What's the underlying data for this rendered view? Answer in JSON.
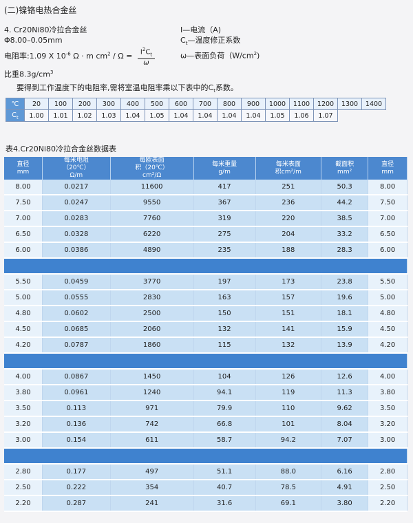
{
  "section_title": "(二)镍铬电热合金丝",
  "spec": {
    "grade": "4. Cr20Ni80冷拉合金丝",
    "diameter_range": "Φ8.00–0.05mm",
    "resistivity_prefix": "电阻率:1.09 X 10",
    "resistivity_exp": "-6",
    "resistivity_unit_a": " Ω · m  cm",
    "resistivity_unit_sup": "2",
    "resistivity_unit_b": " / Ω =",
    "formula_num_a": "I",
    "formula_num_sup": "2",
    "formula_num_b": "C",
    "formula_num_sub": "t",
    "formula_den": "ω",
    "density_prefix": "比重8.3g/cm",
    "density_exp": "3"
  },
  "legend": {
    "current": "I—电流（A)",
    "coef_prefix": "C",
    "coef_sub": "t",
    "coef_text": "—温度修正系数",
    "load_prefix": "ω—表面负荷（W/cm",
    "load_sup": "2",
    "load_suffix": ")"
  },
  "note": {
    "text_a": "要得到工作温度下的电阻率,需将室温电阻率乘以下表中的C",
    "text_sub": "t",
    "text_b": "系数。"
  },
  "ct_table": {
    "row_label_temp": "℃",
    "row_label_ct": "C",
    "row_label_ct_sub": "t",
    "temps": [
      "20",
      "100",
      "200",
      "300",
      "400",
      "500",
      "600",
      "700",
      "800",
      "900",
      "1000",
      "1100",
      "1200",
      "1300",
      "1400"
    ],
    "coefs": [
      "1.00",
      "1.01",
      "1.02",
      "1.03",
      "1.04",
      "1.05",
      "1.04",
      "1.04",
      "1.04",
      "1.04",
      "1.05",
      "1.06",
      "1.07",
      "",
      ""
    ]
  },
  "table_title": "表4.Cr20Ni80冷拉合金丝数据表",
  "data_table": {
    "headers": [
      {
        "l1": "直径",
        "l2": "mm",
        "l3": ""
      },
      {
        "l1": "每米电阻",
        "l2": "（20℃）",
        "l3": "Ω/m"
      },
      {
        "l1": "每欧表面",
        "l2": "积（20℃）",
        "l3": "cm²/Ω"
      },
      {
        "l1": "每米重量",
        "l2": "g/m",
        "l3": ""
      },
      {
        "l1": "每米表面",
        "l2": "积cm²/m",
        "l3": ""
      },
      {
        "l1": "截面积",
        "l2": "mm²",
        "l3": ""
      },
      {
        "l1": "直径",
        "l2": "mm",
        "l3": ""
      }
    ],
    "groups": [
      [
        [
          "8.00",
          "0.0217",
          "11600",
          "417",
          "251",
          "50.3",
          "8.00"
        ],
        [
          "7.50",
          "0.0247",
          "9550",
          "367",
          "236",
          "44.2",
          "7.50"
        ],
        [
          "7.00",
          "0.0283",
          "7760",
          "319",
          "220",
          "38.5",
          "7.00"
        ],
        [
          "6.50",
          "0.0328",
          "6220",
          "275",
          "204",
          "33.2",
          "6.50"
        ],
        [
          "6.00",
          "0.0386",
          "4890",
          "235",
          "188",
          "28.3",
          "6.00"
        ]
      ],
      [
        [
          "5.50",
          "0.0459",
          "3770",
          "197",
          "173",
          "23.8",
          "5.50"
        ],
        [
          "5.00",
          "0.0555",
          "2830",
          "163",
          "157",
          "19.6",
          "5.00"
        ],
        [
          "4.80",
          "0.0602",
          "2500",
          "150",
          "151",
          "18.1",
          "4.80"
        ],
        [
          "4.50",
          "0.0685",
          "2060",
          "132",
          "141",
          "15.9",
          "4.50"
        ],
        [
          "4.20",
          "0.0787",
          "1860",
          "115",
          "132",
          "13.9",
          "4.20"
        ]
      ],
      [
        [
          "4.00",
          "0.0867",
          "1450",
          "104",
          "126",
          "12.6",
          "4.00"
        ],
        [
          "3.80",
          "0.0961",
          "1240",
          "94.1",
          "119",
          "11.3",
          "3.80"
        ],
        [
          "3.50",
          "0.113",
          "971",
          "79.9",
          "110",
          "9.62",
          "3.50"
        ],
        [
          "3.20",
          "0.136",
          "742",
          "66.8",
          "101",
          "8.04",
          "3.20"
        ],
        [
          "3.00",
          "0.154",
          "611",
          "58.7",
          "94.2",
          "7.07",
          "3.00"
        ]
      ],
      [
        [
          "2.80",
          "0.177",
          "497",
          "51.1",
          "88.0",
          "6.16",
          "2.80"
        ],
        [
          "2.50",
          "0.222",
          "354",
          "40.7",
          "78.5",
          "4.91",
          "2.50"
        ],
        [
          "2.20",
          "0.287",
          "241",
          "31.6",
          "69.1",
          "3.80",
          "2.20"
        ]
      ]
    ]
  }
}
